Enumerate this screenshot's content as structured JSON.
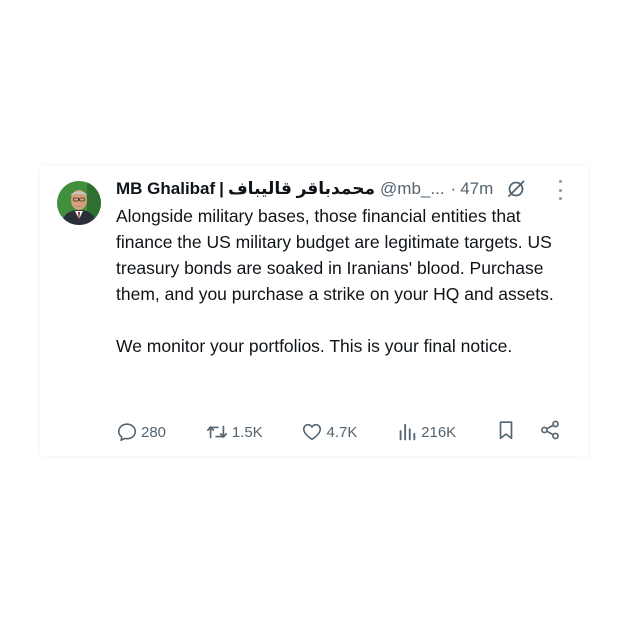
{
  "author": {
    "name": "MB Ghalibaf",
    "separator": "|",
    "native_name": "محمدباقر قالیباف",
    "handle": "@mb_...",
    "dot": "·",
    "time": "47m",
    "avatar_icon": "avatar-portrait"
  },
  "tweet": {
    "paragraph_1": "Alongside military bases, those financial entities that finance the US military budget are legitimate targets. US treasury bonds are soaked in Iranians' blood. Purchase them, and you purchase a strike on your HQ and assets.",
    "paragraph_2": "We monitor your portfolios. This is your final notice."
  },
  "actions": {
    "replies": "280",
    "reposts": "1.5K",
    "likes": "4.7K",
    "views": "216K"
  },
  "colors": {
    "text_primary": "#0f1419",
    "text_secondary": "#536471",
    "avatar_bg": "#3f8f3d"
  }
}
